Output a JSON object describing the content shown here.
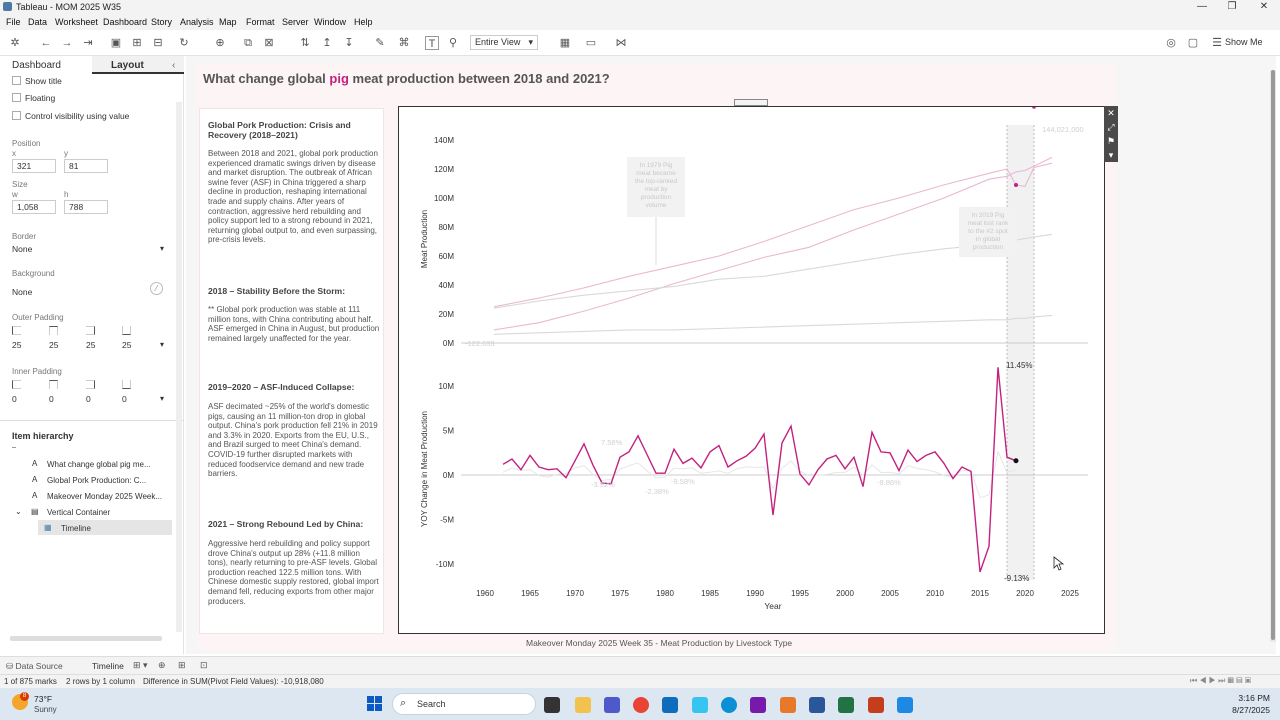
{
  "app": {
    "title": "Tableau - MOM 2025 W35",
    "win_min": "—",
    "win_max": "❐",
    "win_close": "✕"
  },
  "menu": [
    "File",
    "Data",
    "Worksheet",
    "Dashboard",
    "Story",
    "Analysis",
    "Map",
    "Format",
    "Server",
    "Window",
    "Help"
  ],
  "toolbar": {
    "view": "Entire View",
    "show_me": "Show Me"
  },
  "leftpanel": {
    "tab_dashboard": "Dashboard",
    "tab_layout": "Layout",
    "show_title": "Show title",
    "floating": "Floating",
    "control_visibility": "Control visibility using value",
    "position_label": "Position",
    "x_label": "x",
    "y_label": "y",
    "x_value": "321",
    "y_value": "81",
    "size_label": "Size",
    "w_label": "w",
    "h_label": "h",
    "w_value": "1,058",
    "h_value": "788",
    "border_label": "Border",
    "border_value": "None",
    "background_label": "Background",
    "background_value": "None",
    "outer_padding_label": "Outer Padding",
    "outer_padding": [
      "25",
      "25",
      "25",
      "25"
    ],
    "inner_padding_label": "Inner Padding",
    "inner_padding": [
      "0",
      "0",
      "0",
      "0"
    ],
    "hierarchy_label": "Item hierarchy",
    "hierarchy": [
      {
        "label": "What change global pig me...",
        "icon": "A"
      },
      {
        "label": "Global Pork Production: C...",
        "icon": "A"
      },
      {
        "label": "Makeover Monday 2025 Week...",
        "icon": "A"
      },
      {
        "label": "Vertical Container",
        "icon": "▤"
      },
      {
        "label": "Timeline",
        "icon": "▦"
      }
    ]
  },
  "dashboard": {
    "title_pre": "What change global ",
    "title_pig": "pig",
    "title_post": " meat production between 2018 and 2021?",
    "caption": "Makeover Monday 2025 Week 35 - Meat Production by Livestock Type",
    "sections": [
      {
        "heading": "Global Pork Production: Crisis and Recovery (2018–2021)",
        "body": "Between 2018 and 2021, global pork production experienced dramatic swings driven by disease and market disruption. The outbreak of African swine fever (ASF) in China triggered a sharp decline in production, reshaping international trade and supply chains. After years of contraction, aggressive herd rebuilding and policy support led to a strong rebound in 2021, returning global output to, and even surpassing, pre-crisis levels."
      },
      {
        "heading": "2018 – Stability Before the Storm:",
        "body": "** Global pork production was stable at 111 million tons, with China contributing about half. ASF emerged in China in August, but production remained largely unaffected for the year."
      },
      {
        "heading": "2019–2020 – ASF-Induced Collapse:",
        "body": "ASF decimated ~25% of the world's domestic pigs, causing an 11 million-ton drop in global output. China's pork production fell 21% in 2019 and 3.3% in 2020. Exports from the EU, U.S., and Brazil surged to meet China's demand. COVID-19 further disrupted markets with reduced foodservice demand and new trade barriers."
      },
      {
        "heading": "2021 – Strong Rebound Led by China:",
        "body": "Aggressive herd rebuilding and policy support drove China's output up 28% (+11.8 million tons), nearly returning to pre-ASF levels. Global production reached 122.5 million tons. With Chinese domestic supply restored, global import demand fell, reducing exports from other major producers."
      }
    ]
  },
  "chart_data": [
    {
      "type": "line",
      "ylabel": "Meat Production",
      "yticks": [
        "0M",
        "20M",
        "40M",
        "60M",
        "80M",
        "100M",
        "120M",
        "140M"
      ],
      "ylim": [
        0,
        150000000
      ],
      "annotations": [
        "144,021,000",
        "-122,633",
        "In 1979 Pig meat became the top-ranked meat by production volume",
        "In 2019 Pig meat lost rank to the #2 spot in global production"
      ],
      "x": [
        1961,
        1966,
        1971,
        1976,
        1981,
        1986,
        1991,
        1996,
        2001,
        2006,
        2011,
        2016,
        2018,
        2019,
        2020,
        2021,
        2023
      ],
      "series": [
        {
          "values": [
            25,
            31,
            38,
            46,
            53,
            60,
            70,
            81,
            92,
            100,
            109,
            117,
            120,
            109,
            108,
            121,
            124
          ]
        },
        {
          "values": [
            9,
            14,
            22,
            31,
            41,
            50,
            59,
            66,
            78,
            89,
            100,
            113,
            115,
            118,
            119,
            122,
            128
          ]
        },
        {
          "values": [
            24,
            29,
            33,
            36,
            39,
            44,
            46,
            51,
            56,
            61,
            65,
            68,
            70,
            71,
            72,
            73,
            75
          ]
        },
        {
          "values": [
            6,
            7,
            8,
            9,
            9,
            10,
            11,
            12,
            13,
            14,
            15,
            16,
            16,
            17,
            17,
            18,
            19
          ]
        }
      ]
    },
    {
      "type": "line",
      "ylabel": "YOY Change in Meat Production",
      "yticks": [
        "-10M",
        "-5M",
        "0M",
        "5M",
        "10M"
      ],
      "ylim": [
        -12000000,
        12000000
      ],
      "xlabel": "Year",
      "xticks": [
        "1960",
        "1965",
        "1970",
        "1975",
        "1980",
        "1985",
        "1990",
        "1995",
        "2000",
        "2005",
        "2010",
        "2015",
        "2020",
        "2025"
      ],
      "annotations": [
        "11.45%",
        "-9.13%",
        "7.58%",
        "-3.92%",
        "-2.38%",
        "-9.58%",
        "-9.86%"
      ],
      "x": [
        1962,
        1963,
        1964,
        1965,
        1966,
        1967,
        1968,
        1969,
        1970,
        1971,
        1972,
        1973,
        1974,
        1975,
        1976,
        1977,
        1978,
        1979,
        1980,
        1981,
        1982,
        1983,
        1984,
        1985,
        1986,
        1987,
        1988,
        1989,
        1990,
        1991,
        1992,
        1993,
        1994,
        1995,
        1996,
        1997,
        1998,
        1999,
        2000,
        2001,
        2002,
        2003,
        2004,
        2005,
        2006,
        2007,
        2008,
        2009,
        2010,
        2011,
        2012,
        2013,
        2014,
        2015,
        2016,
        2017,
        2018,
        2019,
        2020,
        2021,
        2022,
        2023
      ],
      "series": [
        {
          "name": "Pig meat",
          "values": [
            1.2,
            1.8,
            0.6,
            2.2,
            0.9,
            0.6,
            0.7,
            -0.3,
            1.6,
            3.5,
            1.1,
            -0.9,
            -1,
            2,
            2.6,
            4.4,
            2.3,
            0.2,
            0.2,
            2.9,
            1.3,
            1.9,
            0.8,
            2.6,
            3.3,
            0.9,
            1.6,
            2.1,
            3,
            4.6,
            -4.5,
            3.6,
            5.5,
            0.1,
            -1.1,
            0.6,
            1.8,
            2.2,
            0.7,
            2,
            -1.3,
            4.8,
            2.6,
            2.5,
            0.5,
            2.8,
            1.5,
            2.2,
            2.6,
            1.3,
            -0.4,
            0.9,
            0.4,
            -10.9,
            -8,
            12.1,
            2,
            1.6
          ]
        }
      ]
    }
  ],
  "sheettabs": {
    "data_source": "Data Source",
    "timeline": "Timeline"
  },
  "statusbar": {
    "marks": "1 of 875 marks",
    "rows": "2 rows by 1 column",
    "sum": "Difference in SUM(Pivot Field Values): -10,918,080"
  },
  "taskbar": {
    "temp": "73°F",
    "weather": "Sunny",
    "search": "Search",
    "time": "3:16 PM",
    "date": "8/27/2025",
    "badge": "8"
  },
  "colors": {
    "pig": "#c2227f",
    "pink_light": "#e9b8d3",
    "grey_light": "#d9d9d9"
  }
}
